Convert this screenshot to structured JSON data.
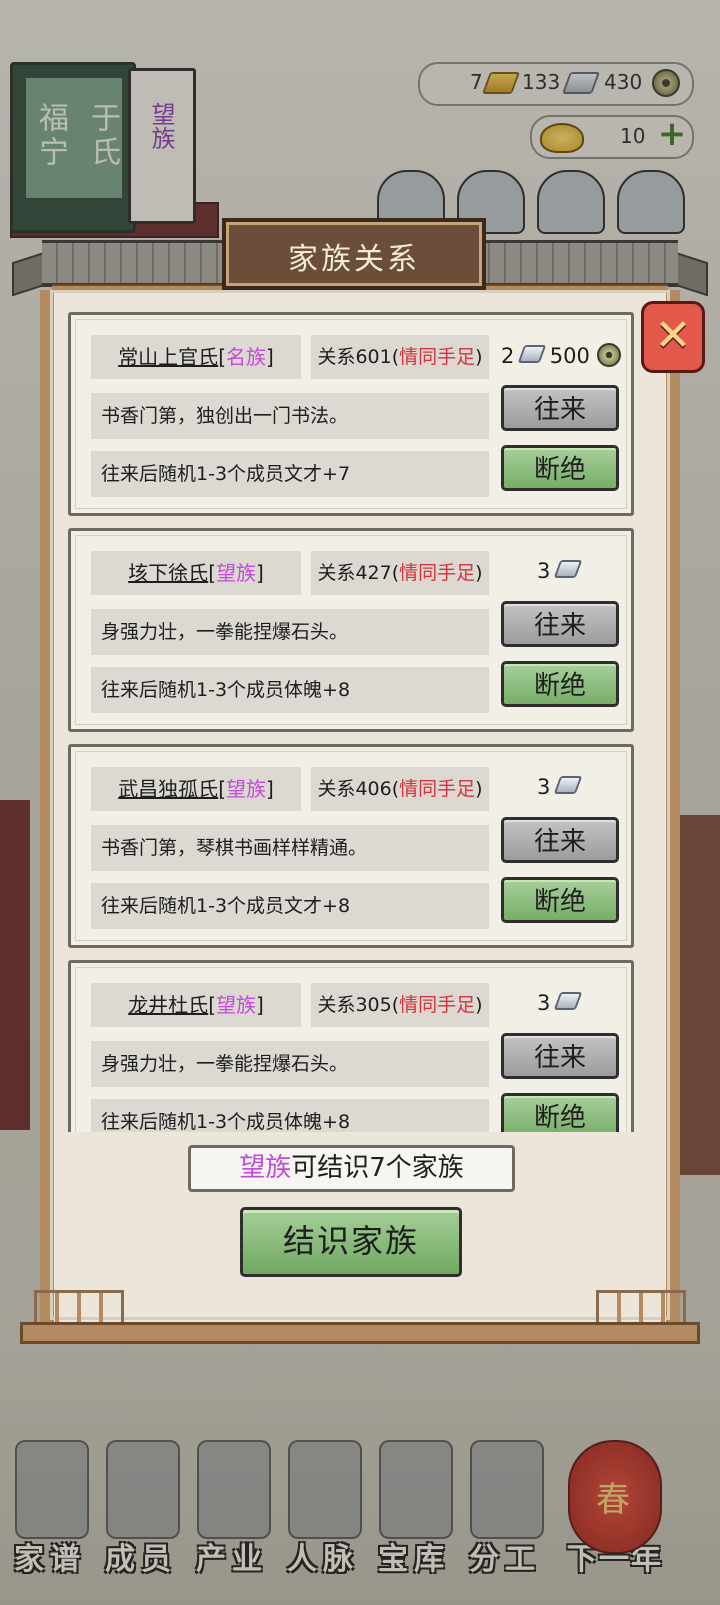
{
  "hud": {
    "family_name_part1": "福宁",
    "family_name_part2": "于氏",
    "family_rank": "望族",
    "gold": "7",
    "silver": "133",
    "coins": "430",
    "ingots": "10"
  },
  "dialog": {
    "title": "家族关系",
    "families": [
      {
        "name": "常山上官氏",
        "rank": "名族",
        "relation_prefix": "关系601(",
        "relation_status": "情同手足",
        "relation_suffix": ")",
        "desc": "书香门第，独创出一门书法。",
        "effect": "往来后随机1-3个成员文才+7",
        "cost_silver": "2",
        "cost_coins": "500",
        "visit_label": "往来",
        "break_label": "断绝"
      },
      {
        "name": "垓下徐氏",
        "rank": "望族",
        "relation_prefix": "关系427(",
        "relation_status": "情同手足",
        "relation_suffix": ")",
        "desc": "身强力壮，一拳能捏爆石头。",
        "effect": "往来后随机1-3个成员体魄+8",
        "cost_silver": "3",
        "visit_label": "往来",
        "break_label": "断绝"
      },
      {
        "name": "武昌独孤氏",
        "rank": "望族",
        "relation_prefix": "关系406(",
        "relation_status": "情同手足",
        "relation_suffix": ")",
        "desc": "书香门第，琴棋书画样样精通。",
        "effect": "往来后随机1-3个成员文才+8",
        "cost_silver": "3",
        "visit_label": "往来",
        "break_label": "断绝"
      },
      {
        "name": "龙井杜氏",
        "rank": "望族",
        "relation_prefix": "关系305(",
        "relation_status": "情同手足",
        "relation_suffix": ")",
        "desc": "身强力壮，一拳能捏爆石头。",
        "effect": "往来后随机1-3个成员体魄+8",
        "cost_silver": "3",
        "visit_label": "往来",
        "break_label": "断绝"
      }
    ],
    "limit_rank": "望族",
    "limit_text": "可结识7个家族",
    "befriend_label": "结识家族",
    "colors": {
      "rank_purple": "#c14ad8",
      "status_red": "#d4333a",
      "button_green": "#8abf7c",
      "button_gray": "#b0b0b0"
    }
  },
  "bottom_nav": [
    {
      "label": "家谱",
      "icon": "book-icon"
    },
    {
      "label": "成员",
      "icon": "person-icon"
    },
    {
      "label": "产业",
      "icon": "building-icon"
    },
    {
      "label": "人脉",
      "icon": "network-icon"
    },
    {
      "label": "宝库",
      "icon": "chest-icon"
    },
    {
      "label": "分工",
      "icon": "scroll-icon"
    },
    {
      "label": "下一年",
      "icon": "lantern-icon"
    }
  ],
  "lantern_char": "春"
}
